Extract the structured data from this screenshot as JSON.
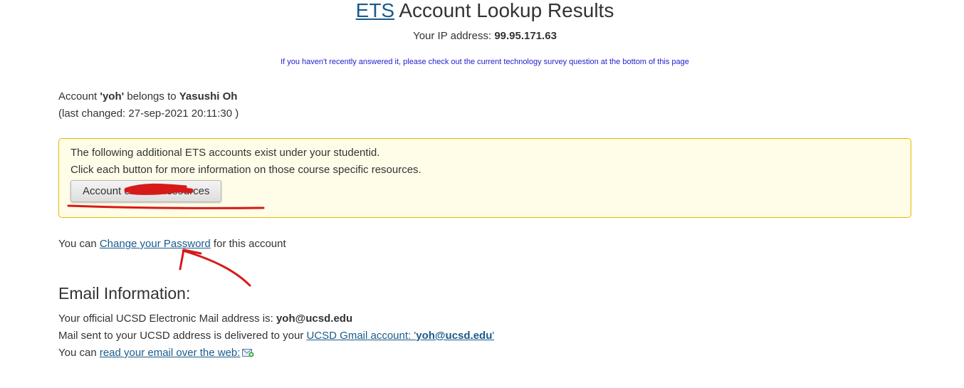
{
  "header": {
    "title_link": "ETS",
    "title_rest": " Account Lookup Results",
    "ip_label": "Your IP address: ",
    "ip_value": "99.95.171.63",
    "survey_notice": "If you haven't recently answered it, please check out the current technology survey question at the bottom of this page"
  },
  "account": {
    "prefix": "Account ",
    "username": "'yoh'",
    "belongs_to": " belongs to ",
    "owner_name": "Yasushi Oh",
    "last_changed": "(last changed: 27-sep-2021 20:11:30 )"
  },
  "additional_accounts": {
    "line1": "The following additional ETS accounts exist under your studentid.",
    "line2": "Click each button for more information on those course specific resources.",
    "button_prefix": "Account ",
    "button_hidden": "cs20fa",
    "button_suffix": " Resources"
  },
  "password": {
    "prefix": "You can ",
    "link": "Change your Password",
    "suffix": " for this account"
  },
  "email": {
    "heading": "Email Information:",
    "official_label": "Your official UCSD Electronic Mail address is: ",
    "official_address": "yoh@ucsd.edu",
    "delivered_label": "Mail sent to your UCSD address is delivered to your ",
    "gmail_link_prefix": "UCSD Gmail account: '",
    "gmail_link_address": "yoh@ucsd.edu",
    "gmail_link_suffix": "'",
    "web_prefix": "You can ",
    "web_link": "read your email over the web:",
    "web_icon": "mail-icon"
  },
  "colors": {
    "link": "#1a5b8c",
    "survey": "#2222cc",
    "notice_border": "#e6b800",
    "notice_bg": "#fffde8",
    "annotation": "#d61a1a"
  }
}
